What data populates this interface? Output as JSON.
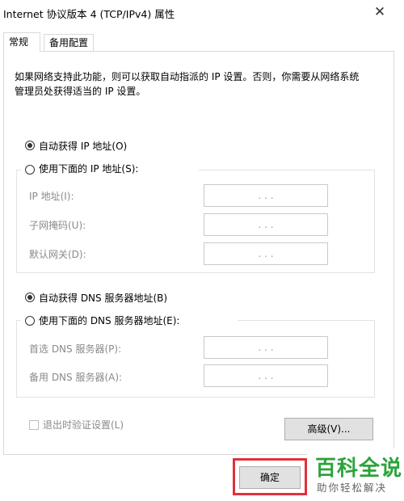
{
  "window": {
    "title": "Internet 协议版本 4 (TCP/IPv4) 属性",
    "close_glyph": "✕"
  },
  "tabs": [
    {
      "label": "常规",
      "active": true
    },
    {
      "label": "备用配置",
      "active": false
    }
  ],
  "intro": "如果网络支持此功能，则可以获取自动指派的 IP 设置。否则，你需要从网络系统管理员处获得适当的 IP 设置。",
  "ip_section": {
    "auto_label": "自动获得 IP 地址(O)",
    "auto_selected": true,
    "manual_label": "使用下面的 IP 地址(S):",
    "manual_selected": false,
    "fields": [
      {
        "label": "IP 地址(I):",
        "value": ". . ."
      },
      {
        "label": "子网掩码(U):",
        "value": ". . ."
      },
      {
        "label": "默认网关(D):",
        "value": ". . ."
      }
    ]
  },
  "dns_section": {
    "auto_label": "自动获得 DNS 服务器地址(B)",
    "auto_selected": true,
    "manual_label": "使用下面的 DNS 服务器地址(E):",
    "manual_selected": false,
    "fields": [
      {
        "label": "首选 DNS 服务器(P):",
        "value": ". . ."
      },
      {
        "label": "备用 DNS 服务器(A):",
        "value": ". . ."
      }
    ]
  },
  "validate_on_exit": {
    "label": "退出时验证设置(L)",
    "checked": false,
    "enabled": false
  },
  "buttons": {
    "advanced": "高级(V)...",
    "ok": "确定"
  },
  "watermark": {
    "logo": "百科全说",
    "sub": "助你轻松解决"
  },
  "colors": {
    "highlight": "#e0313b",
    "watermark_green": "#2ca33b"
  }
}
